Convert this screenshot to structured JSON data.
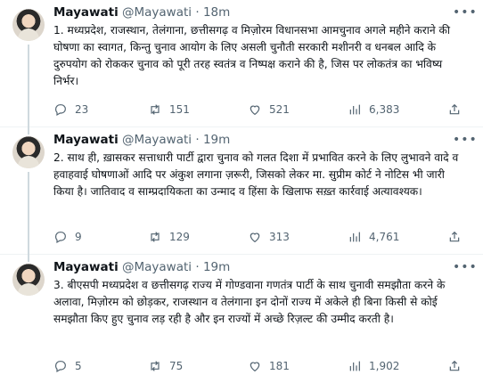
{
  "tweets": [
    {
      "name": "Mayawati",
      "handle": "@Mayawati",
      "dot": "·",
      "time": "18m",
      "text": "1. मध्यप्रदेश, राजस्थान, तेलंगाना, छत्तीसगढ़ व मिज़ोरम विधानसभा आमचुनाव अगले महीने कराने की घोषणा का स्वागत, किन्तु चुनाव आयोग के लिए असली चुनौती सरकारी मशीनरी व धनबल आदि के दुरुपयोग को रोककर चुनाव को पूरी तरह स्वतंत्र व निष्पक्ष कराने की है, जिस पर लोकतंत्र का भविष्य निर्भर।",
      "replies": "23",
      "retweets": "151",
      "likes": "521",
      "views": "6,383"
    },
    {
      "name": "Mayawati",
      "handle": "@Mayawati",
      "dot": "·",
      "time": "19m",
      "text": "2. साथ ही, ख़ासकर सत्ताधारी पार्टी द्वारा चुनाव को गलत दिशा में प्रभावित करने के लिए लुभावने वादे व हवाहवाई घोषणाओं आदि पर अंकुश लगाना ज़रूरी, जिसको लेकर मा. सुप्रीम कोर्ट ने नोटिस भी जारी किया है। जातिवाद व साम्प्रदायिकता का उन्माद व हिंसा के खिलाफ सख़्त कार्रवाई अत्यावश्यक।",
      "replies": "9",
      "retweets": "129",
      "likes": "313",
      "views": "4,761"
    },
    {
      "name": "Mayawati",
      "handle": "@Mayawati",
      "dot": "·",
      "time": "19m",
      "text": "3. बीएसपी मध्यप्रदेश व छत्तीसगढ़ राज्य में गोण्डवाना गणतंत्र पार्टी के साथ चुनावी समझौता करने के अलावा, मिज़ोरम को छोड़कर, राजस्थान व तेलंगाना इन दोनों राज्य में अकेले ही बिना किसी से कोई समझौता किए हुए चुनाव लड़ रही है और इन राज्यों में अच्छे रिज़ल्ट की उम्मीद करती है।",
      "replies": "5",
      "retweets": "75",
      "likes": "181",
      "views": "1,902"
    }
  ],
  "icons": {
    "more": "more-icon",
    "reply": "reply-icon",
    "retweet": "retweet-icon",
    "like": "heart-icon",
    "views": "views-icon",
    "share": "share-icon"
  },
  "colors": {
    "text": "#0f1419",
    "secondary": "#536471",
    "thread_line": "#cfd9de",
    "divider": "#eff3f4"
  }
}
